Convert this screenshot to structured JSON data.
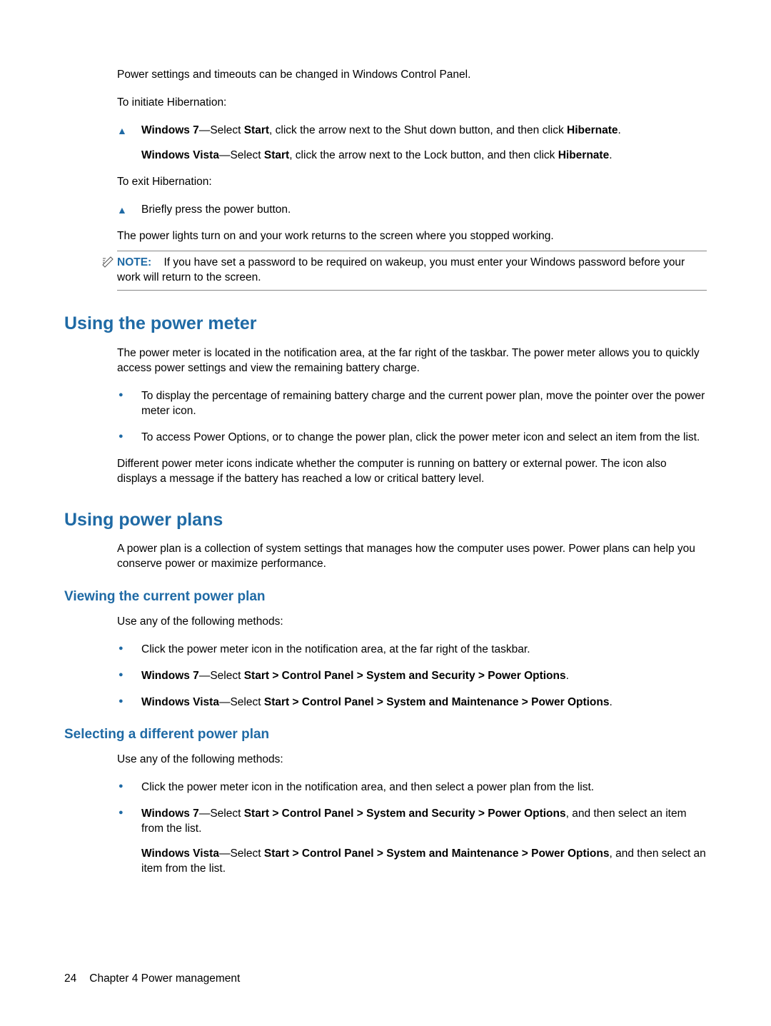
{
  "intro": {
    "p1": "Power settings and timeouts can be changed in Windows Control Panel.",
    "p2": "To initiate Hibernation:",
    "step_win7_a": "Windows 7",
    "step_win7_b": "—Select ",
    "step_win7_c": "Start",
    "step_win7_d": ", click the arrow next to the Shut down button, and then click ",
    "step_win7_e": "Hibernate",
    "step_win7_f": ".",
    "step_vista_a": "Windows Vista",
    "step_vista_b": "—Select ",
    "step_vista_c": "Start",
    "step_vista_d": ", click the arrow next to the Lock button, and then click ",
    "step_vista_e": "Hibernate",
    "step_vista_f": ".",
    "p3": "To exit Hibernation:",
    "step_exit": "Briefly press the power button.",
    "p4": "The power lights turn on and your work returns to the screen where you stopped working.",
    "note_label": "NOTE:",
    "note_body": "If you have set a password to be required on wakeup, you must enter your Windows password before your work will return to the screen."
  },
  "sec1": {
    "title": "Using the power meter",
    "p1": "The power meter is located in the notification area, at the far right of the taskbar. The power meter allows you to quickly access power settings and view the remaining battery charge.",
    "b1": "To display the percentage of remaining battery charge and the current power plan, move the pointer over the power meter icon.",
    "b2": "To access Power Options, or to change the power plan, click the power meter icon and select an item from the list.",
    "p2": "Different power meter icons indicate whether the computer is running on battery or external power. The icon also displays a message if the battery has reached a low or critical battery level."
  },
  "sec2": {
    "title": "Using power plans",
    "p1": "A power plan is a collection of system settings that manages how the computer uses power. Power plans can help you conserve power or maximize performance."
  },
  "sec3": {
    "title": "Viewing the current power plan",
    "p1": "Use any of the following methods:",
    "b1": "Click the power meter icon in the notification area, at the far right of the taskbar.",
    "b2_a": "Windows 7",
    "b2_b": "—Select ",
    "b2_c": "Start > Control Panel > System and Security > Power Options",
    "b2_d": ".",
    "b3_a": "Windows Vista",
    "b3_b": "—Select ",
    "b3_c": "Start > Control Panel > System and Maintenance > Power Options",
    "b3_d": "."
  },
  "sec4": {
    "title": "Selecting a different power plan",
    "p1": "Use any of the following methods:",
    "b1": "Click the power meter icon in the notification area, and then select a power plan from the list.",
    "b2_a": "Windows 7",
    "b2_b": "—Select ",
    "b2_c": "Start > Control Panel > System and Security > Power Options",
    "b2_d": ", and then select an item from the list.",
    "b2s_a": "Windows Vista",
    "b2s_b": "—Select ",
    "b2s_c": "Start > Control Panel > System and Maintenance > Power Options",
    "b2s_d": ", and then select an item from the list."
  },
  "footer": {
    "page": "24",
    "chapter": "Chapter 4   Power management"
  }
}
